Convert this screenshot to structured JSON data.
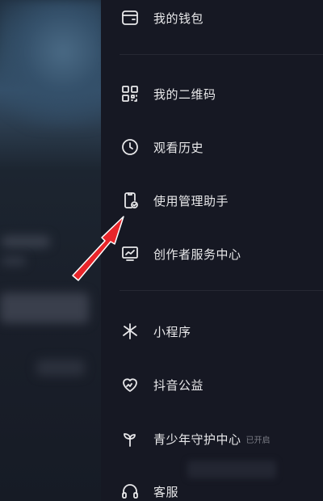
{
  "menu": {
    "items": [
      {
        "label": "我的钱包",
        "icon": "wallet-icon"
      },
      {
        "label": "我的二维码",
        "icon": "qr-code-icon"
      },
      {
        "label": "观看历史",
        "icon": "clock-icon"
      },
      {
        "label": "使用管理助手",
        "icon": "phone-check-icon"
      },
      {
        "label": "创作者服务中心",
        "icon": "chart-monitor-icon"
      },
      {
        "label": "小程序",
        "icon": "mini-program-icon"
      },
      {
        "label": "抖音公益",
        "icon": "heart-charity-icon"
      },
      {
        "label": "青少年守护中心",
        "icon": "sprout-icon",
        "badge": "已开启"
      },
      {
        "label": "客服",
        "icon": "headset-icon"
      }
    ]
  },
  "colors": {
    "background": "#161823",
    "text": "#e8e8ea",
    "badge": "#7a7c85",
    "arrow": "#e8252a"
  }
}
